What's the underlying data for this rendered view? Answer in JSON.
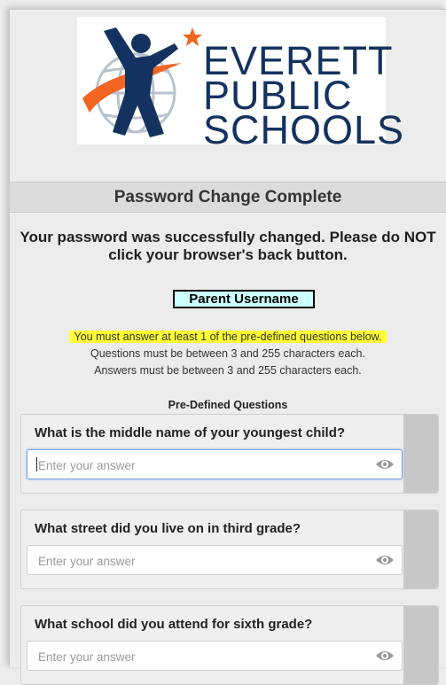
{
  "logo": {
    "line1": "EVERETT",
    "line2": "PUBLIC",
    "line3": "SCHOOLS"
  },
  "page_title": "Password Change Complete",
  "success_message": "Your password was successfully changed. Please do NOT click your browser's back button.",
  "username_button": "Parent Username",
  "rules": {
    "highlight": "You must answer at least 1 of the pre-defined questions below.",
    "questions_len": "Questions must be between 3 and 255 characters each.",
    "answers_len": "Answers must be between 3 and 255 characters each."
  },
  "predefined_heading": "Pre-Defined Questions",
  "questions": [
    {
      "text": "What is the middle name of your youngest child?",
      "placeholder": "Enter your answer"
    },
    {
      "text": "What street did you live on in third grade?",
      "placeholder": "Enter your answer"
    },
    {
      "text": "What school did you attend for sixth grade?",
      "placeholder": "Enter your answer"
    }
  ],
  "colors": {
    "logo_navy": "#14325f",
    "logo_orange": "#f26522",
    "highlight": "#ffff33",
    "username_bg": "#ccffff"
  }
}
